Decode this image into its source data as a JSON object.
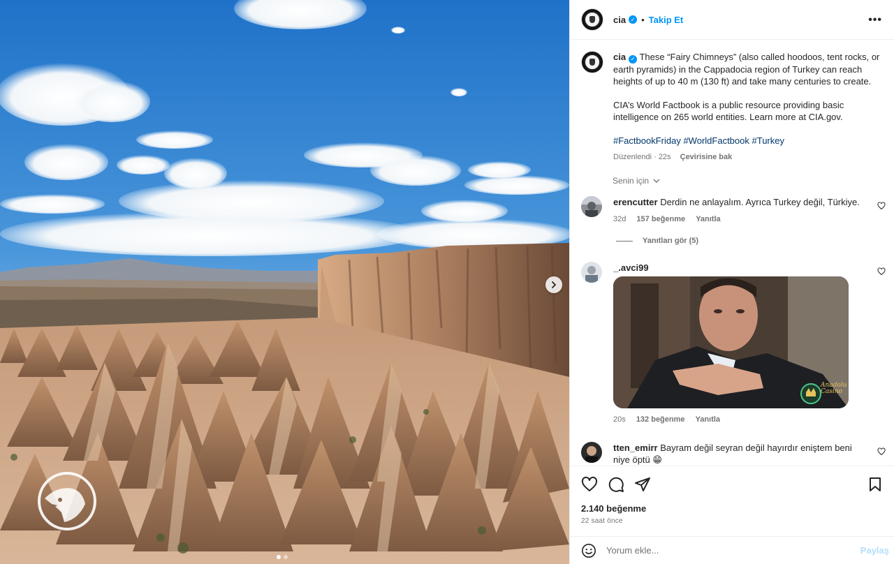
{
  "header": {
    "username": "cia",
    "separator": "•",
    "follow_label": "Takip Et",
    "more_label": "•••"
  },
  "caption": {
    "username": "cia",
    "paragraph1": "These “Fairy Chimneys” (also called hoodoos, tent rocks, or earth pyramids) in the Cappadocia region of Turkey can reach heights of up to 40 m (130 ft) and take many centuries to create.",
    "paragraph2": "CIA’s World Factbook is a public resource providing basic intelligence on 265 world entities. Learn more at CIA.gov.",
    "hashtags": [
      "#FactbookFriday",
      "#WorldFactbook",
      "#Turkey"
    ],
    "edited": "Düzenlendi · 22s",
    "translate": "Çevirisine bak"
  },
  "sort": {
    "label": "Senin için",
    "icon": "chevron-down-icon"
  },
  "comments": [
    {
      "username": "erencutter",
      "text": "Derdin ne anlayalım. Ayrıca Turkey değil, Türkiye.",
      "age": "32d",
      "likes": "157 beğenme",
      "reply": "Yanıtla",
      "view_replies": "Yanıtları gör (5)"
    },
    {
      "username": "_.avci99",
      "text": "",
      "age": "20s",
      "likes": "132 beğenme",
      "reply": "Yanıtla",
      "gif_logo_line1": "Anadolu",
      "gif_logo_line2": "Casino"
    },
    {
      "username": "tten_emirr",
      "text": "Bayram değil seyran değil hayırdır eniştem beni niye öptü 😁"
    }
  ],
  "actions": {
    "likes": "2.140 beğenme",
    "time": "22 saat önce",
    "icons": [
      "heart-icon",
      "comment-icon",
      "share-icon",
      "bookmark-icon"
    ]
  },
  "add_comment": {
    "placeholder": "Yorum ekle...",
    "post_label": "Paylaş",
    "icon": "emoji-icon"
  },
  "colors": {
    "accent": "#0095f6",
    "link": "#00376b",
    "muted": "#737373",
    "sky": "#3a86d4",
    "rock": "#a8795a"
  }
}
